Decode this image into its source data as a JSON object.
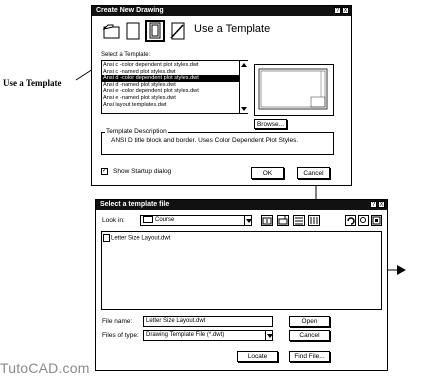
{
  "callout": {
    "label": "Use a Template"
  },
  "watermark": "TutoCAD.com",
  "dialog1": {
    "title": "Create New Drawing",
    "title_btns": [
      "?",
      "X"
    ],
    "heading": "Use a Template",
    "select_label": "Select a Template:",
    "templates": [
      "Ansi c -color dependent plot styles.dwt",
      "Ansi c -named plot styles.dwt",
      "Ansi d -color dependent plot styles.dwt",
      "Ansi d -named plot styles.dwt",
      "Ansi e -color dependent plot styles.dwt",
      "Ansi e -named plot styles.dwt",
      "Ansi layout templates.dwt"
    ],
    "selected_index": 2,
    "browse_label": "Browse...",
    "desc_label": "Template Description",
    "desc_text": "ANSI D title block and border. Uses Color Dependent Plot Styles.",
    "startup_label": "Show Startup dialog",
    "startup_checked": true,
    "ok_label": "OK",
    "cancel_label": "Cancel"
  },
  "dialog2": {
    "title": "Select a template file",
    "title_btns": [
      "?",
      "X"
    ],
    "look_in_label": "Look in:",
    "look_in_value": "Course",
    "files": [
      "Letter Size Layout.dwt"
    ],
    "file_name_label": "File name:",
    "file_name_value": "Letter Size Layout.dwt",
    "file_type_label": "Files of type:",
    "file_type_value": "Drawing Template File (*.dwt)",
    "open_label": "Open",
    "cancel_label": "Cancel",
    "locate_label": "Locate",
    "find_label": "Find File..."
  }
}
